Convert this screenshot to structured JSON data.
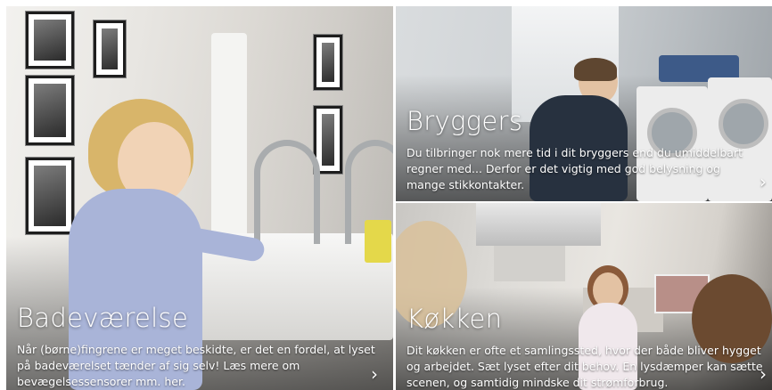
{
  "tiles": [
    {
      "title": "Badeværelse",
      "description": "Når (børne)fingrene er meget beskidte, er det en fordel, at lyset på badeværelset tænder af sig selv! Læs mere om bevægelsessensorer mm. her.",
      "arrow": "›",
      "arrow_icon": "chevron-right-icon"
    },
    {
      "title": "Bryggers",
      "description": "Du tilbringer nok mere tid i dit bryggers end du umiddelbart regner med... Derfor er det vigtig med god belysning og mange stikkontakter.",
      "arrow": "›",
      "arrow_icon": "chevron-right-icon"
    },
    {
      "title": "Køkken",
      "description": "Dit køkken er ofte et samlingssted, hvor der både bliver hygget og arbejdet. Sæt lyset efter dit behov. En lysdæmper kan sætte scenen, og samtidig mindske dit strømforbrug.",
      "arrow": "›",
      "arrow_icon": "chevron-right-icon"
    }
  ]
}
